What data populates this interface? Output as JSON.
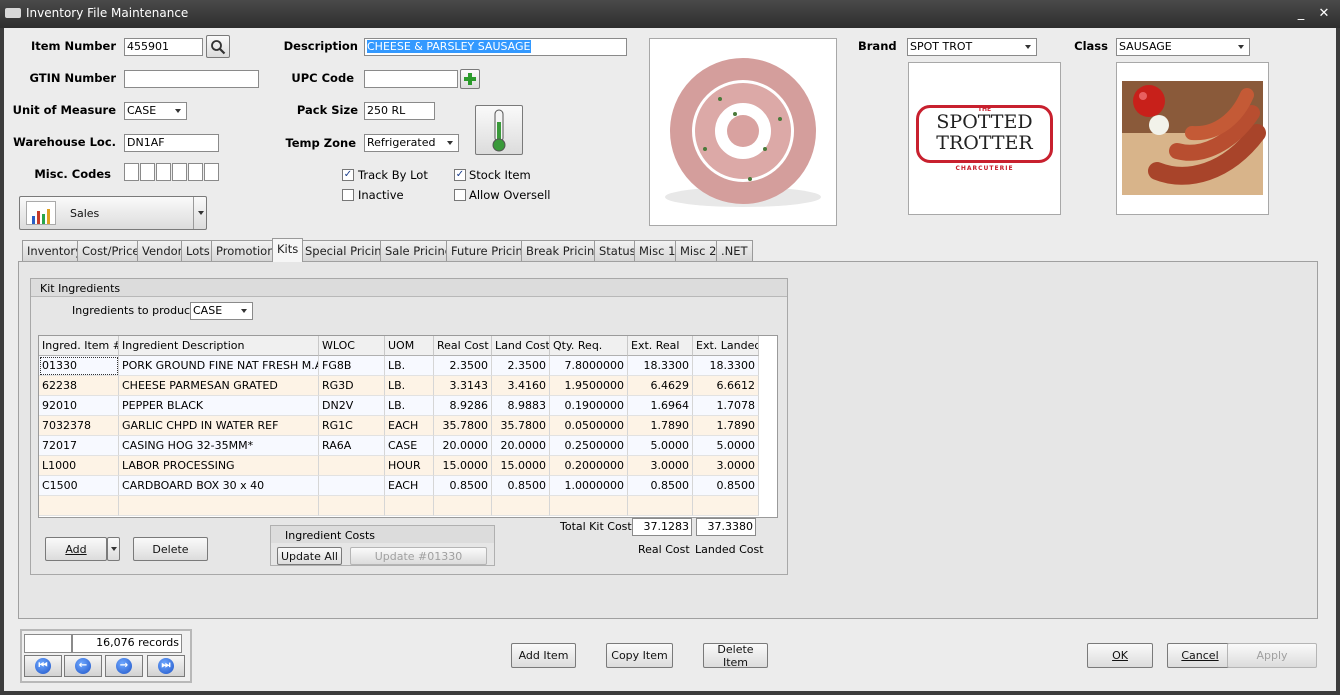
{
  "window": {
    "title": "Inventory File Maintenance",
    "minimize": "_",
    "close": "✕"
  },
  "header": {
    "item_number_label": "Item Number",
    "item_number": "455901",
    "gtin_label": "GTIN Number",
    "gtin": "",
    "uom_label": "Unit of Measure",
    "uom": "CASE",
    "warehouse_label": "Warehouse Loc.",
    "warehouse": "DN1AF",
    "misc_label": "Misc. Codes",
    "description_label": "Description",
    "description": "CHEESE & PARSLEY SAUSAGE",
    "upc_label": "UPC Code",
    "upc": "",
    "pack_label": "Pack Size",
    "pack": "250 RL",
    "temp_label": "Temp Zone",
    "temp": "Refrigerated",
    "brand_label": "Brand",
    "brand": "SPOT TROT",
    "class_label": "Class",
    "class": "SAUSAGE",
    "module": "Sales",
    "brand_logo": {
      "line0": "THE",
      "line1": "SPOTTED",
      "line2": "TROTTER",
      "line3": "CHARCUTERIE"
    }
  },
  "checkboxes": [
    {
      "label": "Track By Lot",
      "checked": true
    },
    {
      "label": "Stock Item",
      "checked": true
    },
    {
      "label": "Inactive",
      "checked": false
    },
    {
      "label": "Allow Oversell",
      "checked": false
    }
  ],
  "tabs": [
    "Inventory",
    "Cost/Price",
    "Vendor",
    "Lots",
    "Promotions",
    "Kits",
    "Special Pricing",
    "Sale Pricing",
    "Future Pricing",
    "Break Pricing",
    "Status",
    "Misc 1",
    "Misc 2",
    ".NET"
  ],
  "active_tab": "Kits",
  "kit": {
    "group_title": "Kit Ingredients",
    "produce_label": "Ingredients to produce:",
    "produce_value": "CASE",
    "columns": [
      "Ingred. Item #",
      "Ingredient Description",
      "WLOC",
      "UOM",
      "Real Cost",
      "Land Cost",
      "Qty. Req.",
      "Ext. Real",
      "Ext. Landed"
    ],
    "rows": [
      [
        "01330",
        "PORK GROUND FINE NAT FRESH M.A.P*",
        "FG8B",
        "LB.",
        "2.3500",
        "2.3500",
        "7.8000000",
        "18.3300",
        "18.3300"
      ],
      [
        "62238",
        "CHEESE PARMESAN GRATED",
        "RG3D",
        "LB.",
        "3.3143",
        "3.4160",
        "1.9500000",
        "6.4629",
        "6.6612"
      ],
      [
        "92010",
        "PEPPER BLACK",
        "DN2V",
        "LB.",
        "8.9286",
        "8.9883",
        "0.1900000",
        "1.6964",
        "1.7078"
      ],
      [
        "7032378",
        "GARLIC  CHPD IN WATER REF",
        "RG1C",
        "EACH",
        "35.7800",
        "35.7800",
        "0.0500000",
        "1.7890",
        "1.7890"
      ],
      [
        "72017",
        "CASING HOG 32-35MM*",
        "RA6A",
        "CASE",
        "20.0000",
        "20.0000",
        "0.2500000",
        "5.0000",
        "5.0000"
      ],
      [
        "L1000",
        "LABOR PROCESSING",
        "",
        "HOUR",
        "15.0000",
        "15.0000",
        "0.2000000",
        "3.0000",
        "3.0000"
      ],
      [
        "C1500",
        "CARDBOARD BOX 30 x 40",
        "",
        "EACH",
        "0.8500",
        "0.8500",
        "1.0000000",
        "0.8500",
        "0.8500"
      ],
      [
        "",
        "",
        "",
        "",
        "",
        "",
        "",
        "",
        ""
      ]
    ],
    "total_label": "Total Kit Cost",
    "total_real": "37.1283",
    "total_landed": "37.3380",
    "real_cost_label": "Real Cost",
    "landed_cost_label": "Landed Cost",
    "add_label": "Add",
    "delete_label": "Delete",
    "ingredient_costs_title": "Ingredient Costs",
    "update_all_label": "Update All",
    "update_one_label": "Update #01330"
  },
  "footer": {
    "records": "16,076 records",
    "add_item": "Add Item",
    "copy_item": "Copy Item",
    "delete_item": "Delete Item",
    "ok": "OK",
    "cancel": "Cancel",
    "apply": "Apply"
  }
}
